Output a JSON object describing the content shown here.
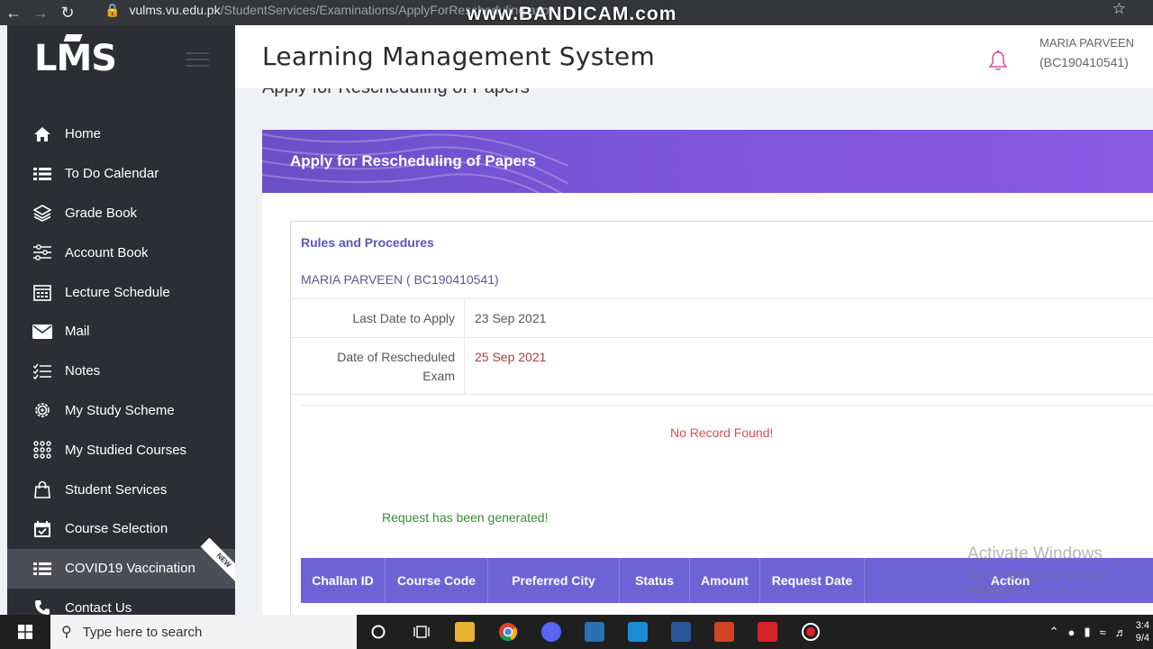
{
  "browser": {
    "url_host": "vulms.vu.edu.pk",
    "url_path": "/StudentServices/Examinations/ApplyForRescheduling.aspx",
    "watermark": "www.BANDICAM.com"
  },
  "sidebar": {
    "logo": "LMS",
    "items": [
      {
        "label": "Home",
        "icon": "home-icon"
      },
      {
        "label": "To Do Calendar",
        "icon": "list-icon"
      },
      {
        "label": "Grade Book",
        "icon": "layers-icon"
      },
      {
        "label": "Account Book",
        "icon": "sliders-icon"
      },
      {
        "label": "Lecture Schedule",
        "icon": "calendar-icon"
      },
      {
        "label": "Mail",
        "icon": "mail-icon"
      },
      {
        "label": "Notes",
        "icon": "checklist-icon"
      },
      {
        "label": "My Study Scheme",
        "icon": "gear-icon"
      },
      {
        "label": "My Studied Courses",
        "icon": "grid-icon"
      },
      {
        "label": "Student Services",
        "icon": "bag-icon"
      },
      {
        "label": "Course Selection",
        "icon": "calendar-check-icon"
      },
      {
        "label": "COVID19 Vaccination",
        "icon": "list-icon",
        "badge": "NEW"
      },
      {
        "label": "Contact Us",
        "icon": "phone-icon"
      }
    ]
  },
  "header": {
    "title": "Learning Management System",
    "user_name": "MARIA PARVEEN",
    "user_id": "(BC190410541)"
  },
  "page": {
    "heading": "Apply for Rescheduling of Papers",
    "banner_title": "Apply for Rescheduling of Papers",
    "rules_link": "Rules and Procedures",
    "student": "MARIA PARVEEN ( BC190410541)",
    "last_date_label": "Last Date to Apply",
    "last_date_value": "23 Sep 2021",
    "resched_label": "Date of Rescheduled Exam",
    "resched_value": "25 Sep 2021",
    "no_record": "No Record Found!",
    "request_msg": "Request has been generated!",
    "columns": [
      "Challan ID",
      "Course Code",
      "Preferred City",
      "Status",
      "Amount",
      "Request Date",
      "Action"
    ]
  },
  "overlay": {
    "activate_title": "Activate Windows",
    "activate_sub": "Go to Settings to activate Windows."
  },
  "taskbar": {
    "search_placeholder": "Type here to search",
    "time": "3:4",
    "date": "9/4"
  },
  "colors": {
    "sidebar": "#2c2e33",
    "banner": "#7b55d9",
    "table_head": "#6e63d6",
    "error": "#d9534f",
    "success": "#3c8a3c"
  }
}
